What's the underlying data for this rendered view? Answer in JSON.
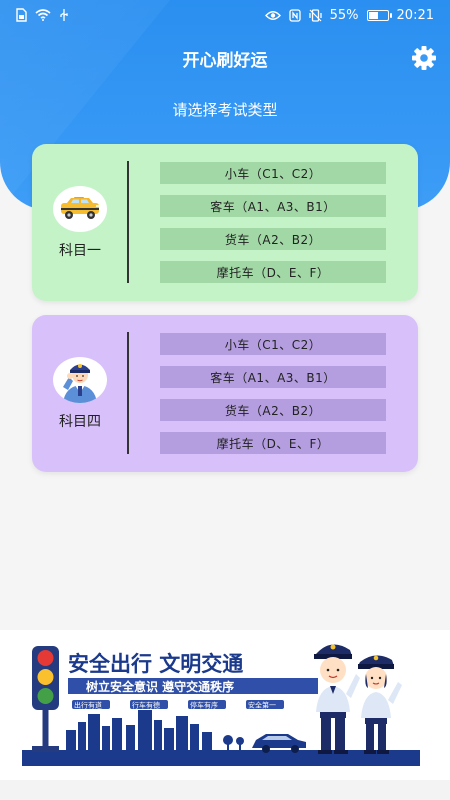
{
  "status_bar": {
    "battery_percent": "55%",
    "battery_level": 0.55,
    "time": "20:21"
  },
  "header": {
    "title": "开心刷好运",
    "subtitle": "请选择考试类型"
  },
  "subjects": [
    {
      "name": "科目一",
      "icon": "taxi-icon",
      "options": [
        "小车（C1、C2）",
        "客车（A1、A3、B1）",
        "货车（A2、B2）",
        "摩托车（D、E、F）"
      ]
    },
    {
      "name": "科目四",
      "icon": "police-officer-icon",
      "options": [
        "小车（C1、C2）",
        "客车（A1、A3、B1）",
        "货车（A2、B2）",
        "摩托车（D、E、F）"
      ]
    }
  ],
  "banner": {
    "headline": "安全出行  文明交通",
    "slogan": "树立安全意识 遵守交通秩序",
    "tags": [
      "出行有道",
      "行车有德",
      "停车有序",
      "安全第一"
    ]
  },
  "colors": {
    "header_blue": "#2a8ff0",
    "card1_bg": "#c4f3c8",
    "card1_option": "#a2d8a6",
    "card2_bg": "#d8c1fa",
    "card2_option": "#b49ee0",
    "banner_headline": "#1b3a8c"
  }
}
